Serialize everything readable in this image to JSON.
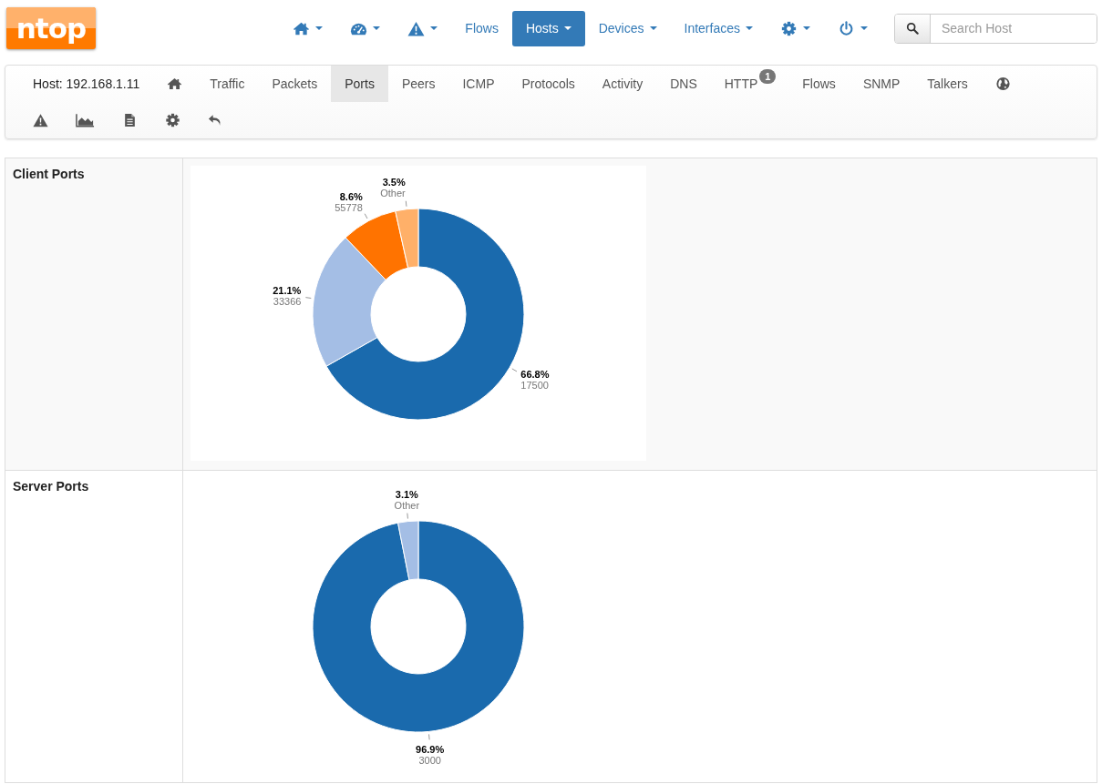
{
  "logo": "ntop",
  "navbar": {
    "items": [
      {
        "kind": "icon",
        "dropdown": true,
        "selected": false
      },
      {
        "kind": "icon",
        "dropdown": true,
        "selected": false
      },
      {
        "kind": "icon",
        "dropdown": true,
        "selected": false
      },
      {
        "kind": "text",
        "label": "Flows",
        "dropdown": false,
        "selected": false
      },
      {
        "kind": "text",
        "label": "Hosts",
        "dropdown": true,
        "selected": true
      },
      {
        "kind": "text",
        "label": "Devices",
        "dropdown": true,
        "selected": false
      },
      {
        "kind": "text",
        "label": "Interfaces",
        "dropdown": true,
        "selected": false
      },
      {
        "kind": "icon",
        "dropdown": true,
        "selected": false
      },
      {
        "kind": "icon",
        "dropdown": true,
        "selected": false
      }
    ],
    "search": {
      "placeholder": "Search Host"
    }
  },
  "host_tabs": {
    "host_label": "Host: 192.168.1.11",
    "items": [
      {
        "kind": "icon",
        "selected": false
      },
      {
        "kind": "text",
        "label": "Traffic",
        "selected": false
      },
      {
        "kind": "text",
        "label": "Packets",
        "selected": false
      },
      {
        "kind": "text",
        "label": "Ports",
        "selected": true
      },
      {
        "kind": "text",
        "label": "Peers",
        "selected": false
      },
      {
        "kind": "text",
        "label": "ICMP",
        "selected": false
      },
      {
        "kind": "text",
        "label": "Protocols",
        "selected": false
      },
      {
        "kind": "text",
        "label": "Activity",
        "selected": false
      },
      {
        "kind": "text",
        "label": "DNS",
        "selected": false
      },
      {
        "kind": "text",
        "label": "HTTP",
        "selected": false,
        "badge": "1"
      },
      {
        "kind": "text",
        "label": "Flows",
        "selected": false
      },
      {
        "kind": "text",
        "label": "SNMP",
        "selected": false
      },
      {
        "kind": "text",
        "label": "Talkers",
        "selected": false
      },
      {
        "kind": "icon",
        "selected": false
      },
      {
        "kind": "icon",
        "selected": false
      },
      {
        "kind": "icon",
        "selected": false
      },
      {
        "kind": "icon",
        "selected": false
      },
      {
        "kind": "icon",
        "selected": false
      },
      {
        "kind": "icon",
        "selected": false
      }
    ]
  },
  "sections": [
    {
      "title": "Client Ports",
      "chart_data": {
        "type": "donut",
        "categories": [
          "17500",
          "33366",
          "55778",
          "Other"
        ],
        "values": [
          66.8,
          21.1,
          8.6,
          3.5
        ],
        "value_labels": [
          "66.8%",
          "21.1%",
          "8.6%",
          "3.5%"
        ]
      }
    },
    {
      "title": "Server Ports",
      "chart_data": {
        "type": "donut",
        "categories": [
          "3000",
          "Other"
        ],
        "values": [
          96.9,
          3.1
        ],
        "value_labels": [
          "96.9%",
          "3.1%"
        ]
      }
    }
  ]
}
